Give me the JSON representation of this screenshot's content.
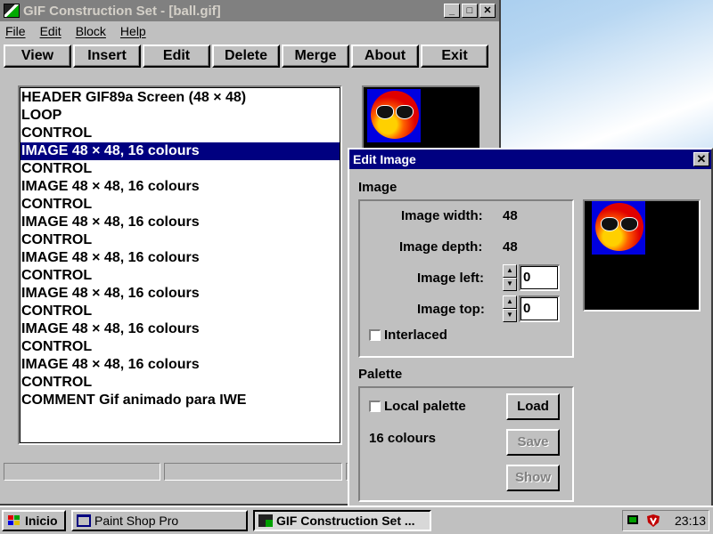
{
  "main_window": {
    "title": "GIF Construction Set - [ball.gif]",
    "controls": [
      "_",
      "□",
      "✕"
    ],
    "menu": [
      "File",
      "Edit",
      "Block",
      "Help"
    ],
    "toolbar": [
      "View",
      "Insert",
      "Edit",
      "Delete",
      "Merge",
      "About",
      "Exit"
    ],
    "blocks": [
      "HEADER GIF89a Screen (48 × 48)",
      "LOOP",
      "CONTROL",
      "IMAGE 48 × 48, 16 colours",
      "CONTROL",
      "IMAGE 48 × 48, 16 colours",
      "CONTROL",
      "IMAGE 48 × 48, 16 colours",
      "CONTROL",
      "IMAGE 48 × 48, 16 colours",
      "CONTROL",
      "IMAGE 48 × 48, 16 colours",
      "CONTROL",
      "IMAGE 48 × 48, 16 colours",
      "CONTROL",
      "IMAGE 48 × 48, 16 colours",
      "CONTROL",
      "COMMENT Gif animado para IWE"
    ],
    "selected_index": 3
  },
  "edit_dialog": {
    "title": "Edit Image",
    "close": "✕",
    "image_group": "Image",
    "width_label": "Image width:",
    "width_value": "48",
    "depth_label": "Image depth:",
    "depth_value": "48",
    "left_label": "Image left:",
    "left_value": "0",
    "top_label": "Image top:",
    "top_value": "0",
    "interlaced_label": "Interlaced",
    "interlaced_checked": false,
    "palette_group": "Palette",
    "local_palette_label": "Local palette",
    "local_palette_checked": false,
    "colours_text": "16 colours",
    "load_label": "Load",
    "save_label": "Save",
    "show_label": "Show"
  },
  "taskbar": {
    "start_label": "Inicio",
    "tasks": [
      "Paint Shop Pro",
      "GIF Construction Set ..."
    ],
    "clock": "23:13"
  },
  "colors": {
    "selection": "#000080",
    "active_title": "#000080",
    "inactive_title": "#808080",
    "face": "#c0c0c0"
  }
}
